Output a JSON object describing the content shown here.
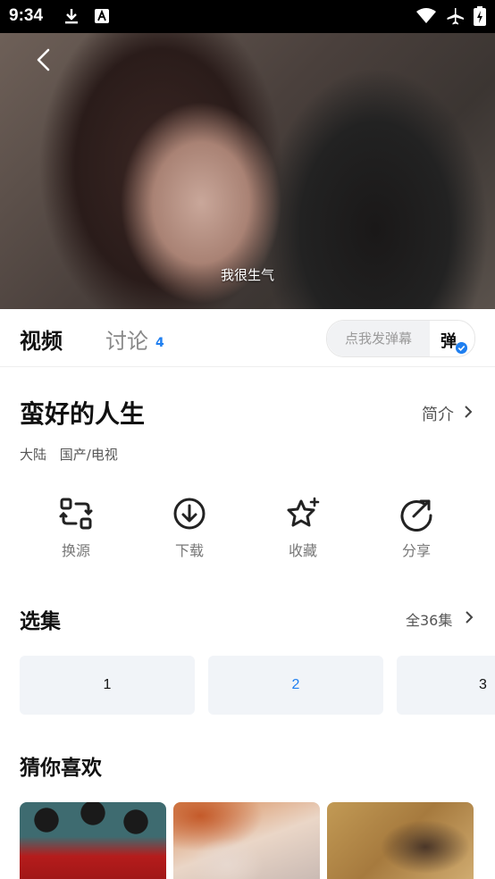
{
  "status_bar": {
    "time": "9:34"
  },
  "player": {
    "subtitle": "我很生气"
  },
  "tabs": {
    "video": "视频",
    "discuss": "讨论",
    "discuss_count": "4",
    "danmu_placeholder": "点我发弹幕",
    "danmu_button": "弹"
  },
  "show": {
    "title": "蛮好的人生",
    "intro_link": "简介",
    "meta": [
      "大陆",
      "国产/电视"
    ]
  },
  "actions": [
    {
      "label": "换源",
      "icon": "switch-source-icon"
    },
    {
      "label": "下载",
      "icon": "download-icon"
    },
    {
      "label": "收藏",
      "icon": "star-icon"
    },
    {
      "label": "分享",
      "icon": "share-icon"
    }
  ],
  "episodes": {
    "section_title": "选集",
    "all_label": "全36集",
    "items": [
      "1",
      "2",
      "3"
    ],
    "active_index": 1
  },
  "recommend": {
    "section_title": "猜你喜欢"
  },
  "colors": {
    "accent": "#1f7ff0",
    "ep_bg": "#f1f4f8"
  }
}
